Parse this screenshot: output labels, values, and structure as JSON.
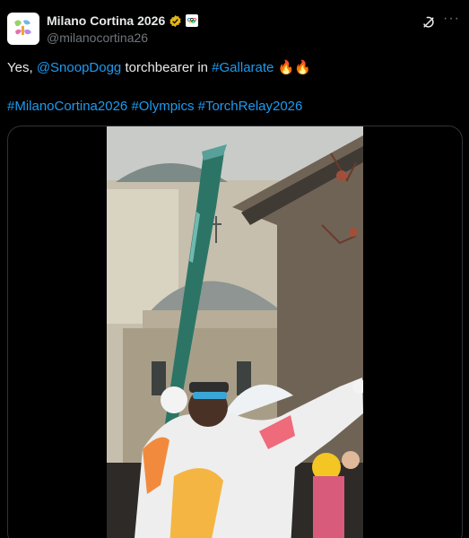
{
  "account": {
    "display_name": "Milano Cortina 2026",
    "handle": "@milanocortina26"
  },
  "post": {
    "line1_prefix": "Yes, ",
    "mention": "@SnoopDogg",
    "line1_middle": " torchbearer in ",
    "place_tag": "#Gallarate",
    "emojis": "🔥🔥",
    "hashtags": [
      "#MilanoCortina2026",
      "#Olympics",
      "#TorchRelay2026"
    ]
  },
  "icons": [
    "avatar-logo",
    "verified-badge-icon",
    "affiliate-badge-icon",
    "grok-icon",
    "more-icon"
  ],
  "colors": {
    "link": "#1d9bf0",
    "verified": "#e2b719",
    "muted": "#71767b"
  }
}
